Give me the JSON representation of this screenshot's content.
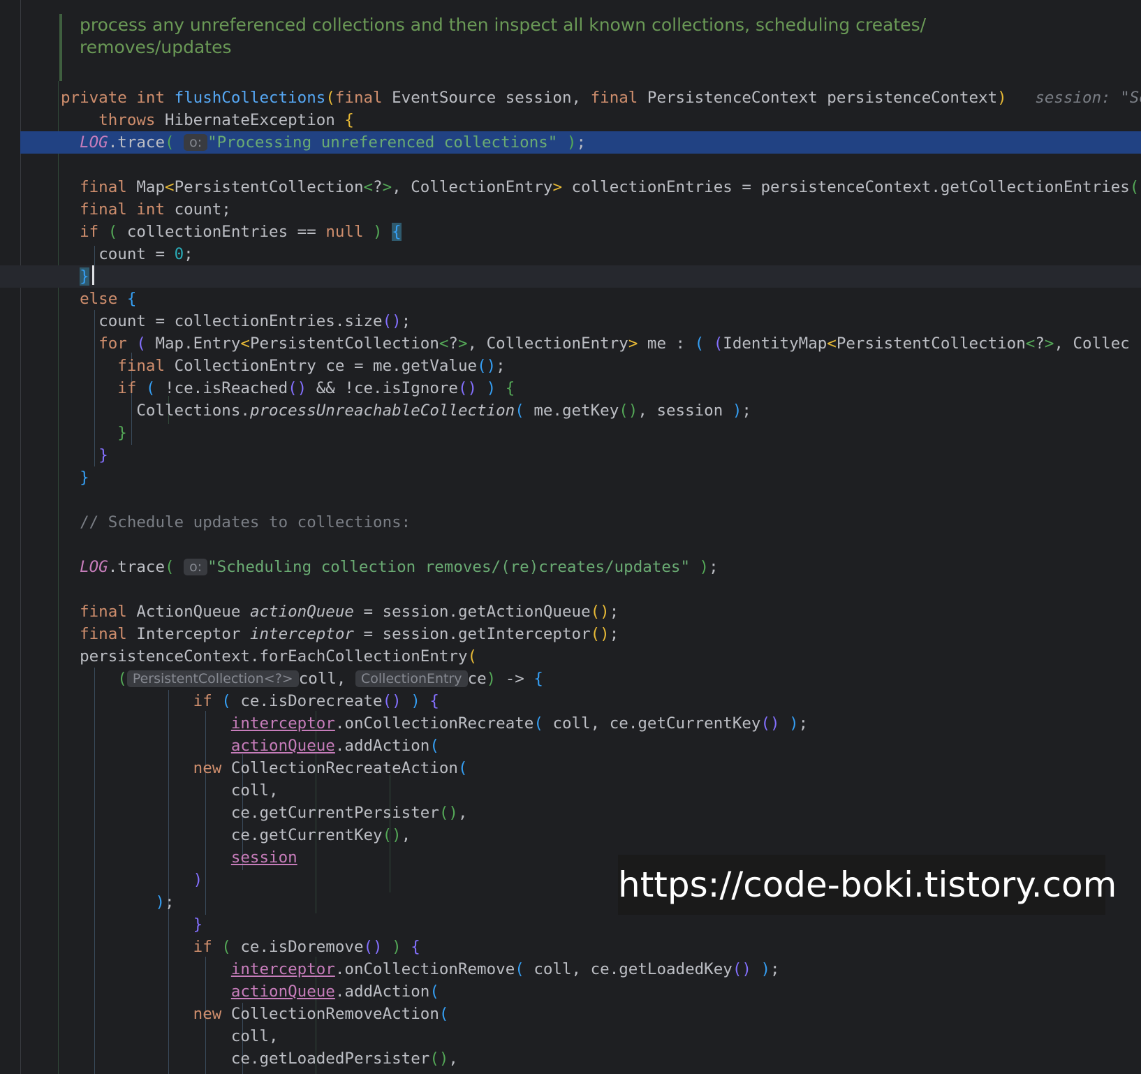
{
  "doc_comment": {
    "line1": "process any unreferenced collections and then inspect all known collections, scheduling creates/",
    "line2": "removes/updates"
  },
  "code": {
    "kw_private": "private",
    "kw_int": "int",
    "kw_final": "final",
    "kw_throws": "throws",
    "kw_if": "if",
    "kw_else": "else",
    "kw_for": "for",
    "kw_new": "new",
    "kw_null": "null",
    "method_name": "flushCollections",
    "type_event_source": "EventSource",
    "type_persistence_context": "PersistenceContext",
    "type_hibernate_exception": "HibernateException",
    "type_map": "Map",
    "type_persistent_collection": "PersistentCollection",
    "type_collection_entry": "CollectionEntry",
    "type_identity_map": "IdentityMap",
    "type_action_queue": "ActionQueue",
    "type_interceptor": "Interceptor",
    "var_session": "session",
    "var_persistence_context": "persistenceContext",
    "var_collection_entries": "collectionEntries",
    "var_count": "count",
    "var_me": "me",
    "var_ce": "ce",
    "var_coll": "coll",
    "var_action_queue": "actionQueue",
    "var_interceptor": "interceptor",
    "log": "LOG",
    "trace": "trace",
    "num_zero": "0",
    "str_processing": "\"Processing unreferenced collections\"",
    "str_scheduling": "\"Scheduling collection removes/(re)creates/updates\"",
    "comment_schedule": "// Schedule updates to collections:",
    "get_collection_entries": "getCollectionEntries",
    "size": "size",
    "map_entry": "Map.Entry",
    "collec_trunc": "Collec",
    "get_value": "getValue",
    "is_reached": "isReached",
    "is_ignore": "isIgnore",
    "collections_cls": "Collections",
    "process_unreachable": "processUnreachableCollection",
    "get_key": "getKey",
    "get_action_queue": "getActionQueue",
    "get_interceptor": "getInterceptor",
    "for_each_collection_entry": "forEachCollectionEntry",
    "is_dorecreate": "isDorecreate",
    "on_collection_recreate": "onCollectionRecreate",
    "get_current_key": "getCurrentKey",
    "add_action": "addAction",
    "collection_recreate_action": "CollectionRecreateAction",
    "get_current_persister": "getCurrentPersister",
    "is_doremove": "isDoremove",
    "on_collection_remove": "onCollectionRemove",
    "get_loaded_key": "getLoadedKey",
    "collection_remove_action": "CollectionRemoveAction",
    "get_loaded_persister": "getLoadedPersister"
  },
  "hints": {
    "o_param": "o:",
    "session_hint": "session: \"Sess",
    "lambda_type_coll": "PersistentCollection<?>",
    "lambda_type_ce": "CollectionEntry"
  },
  "watermark": "https://code-boki.tistory.com"
}
